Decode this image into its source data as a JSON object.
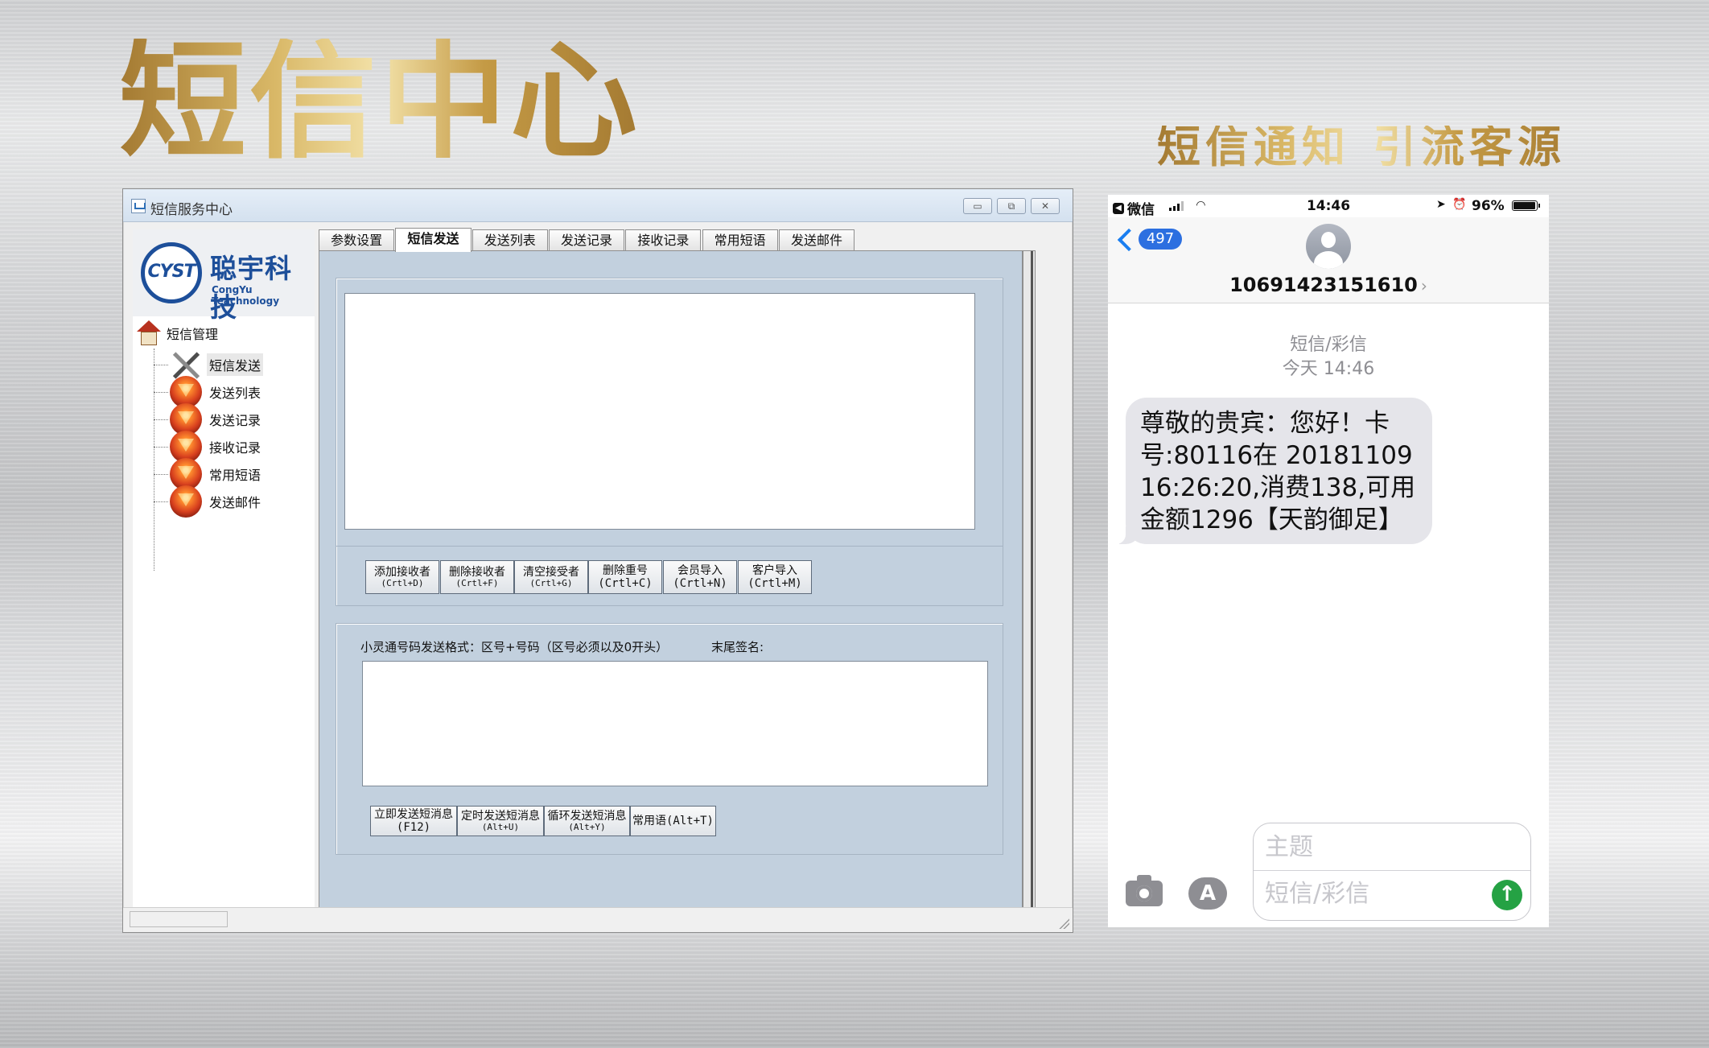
{
  "banner": {
    "title": "短信中心",
    "slogan_left": "短信通知",
    "slogan_right": "引流客源"
  },
  "window": {
    "title": "短信服务中心",
    "controls": {
      "minimize": "▭",
      "maximize": "⧉",
      "close": "✕"
    }
  },
  "logo": {
    "mark": "CYST",
    "name_cn": "聪宇科技",
    "name_en": "CongYu Teachnology"
  },
  "tree": {
    "root": "短信管理",
    "items": [
      "短信发送",
      "发送列表",
      "发送记录",
      "接收记录",
      "常用短语",
      "发送邮件"
    ],
    "selected": 0
  },
  "tabs": [
    "参数设置",
    "短信发送",
    "发送列表",
    "发送记录",
    "接收记录",
    "常用短语",
    "发送邮件"
  ],
  "active_tab": 1,
  "recipient_buttons": [
    {
      "label": "添加接收者",
      "shortcut": "(Crtl+D)"
    },
    {
      "label": "删除接收者",
      "shortcut": "(Crtl+F)"
    },
    {
      "label": "清空接受者",
      "shortcut": "(Crtl+G)"
    },
    {
      "label": "删除重号(Crtl+C)",
      "shortcut": ""
    },
    {
      "label": "会员导入(Crtl+N)",
      "shortcut": ""
    },
    {
      "label": "客户导入(Crtl+M)",
      "shortcut": ""
    }
  ],
  "compose": {
    "format_hint": "小灵通号码发送格式：区号+号码（区号必须以及0开头）",
    "signature_label": "末尾签名:"
  },
  "send_buttons": [
    {
      "label": "立即发送短消息(F12)",
      "shortcut": ""
    },
    {
      "label": "定时发送短消息",
      "shortcut": "(Alt+U)"
    },
    {
      "label": "循环发送短消息",
      "shortcut": "(Alt+Y)"
    },
    {
      "label": "常用语(Alt+T)",
      "shortcut": ""
    }
  ],
  "phone": {
    "status": {
      "back_app": "微信",
      "time": "14:46",
      "battery": "96%",
      "battery_level": 0.96
    },
    "nav": {
      "unread_count": "497",
      "contact_number": "10691423151610",
      "chevron": "›"
    },
    "thread": {
      "type": "短信/彩信",
      "timestamp": "今天 14:46",
      "message": "尊敬的贵宾：您好！卡号:80116在 20181109 16:26:20,消费138,可用金额1296【天韵御足】"
    },
    "compose": {
      "subject_placeholder": "主题",
      "body_placeholder": "短信/彩信"
    }
  }
}
